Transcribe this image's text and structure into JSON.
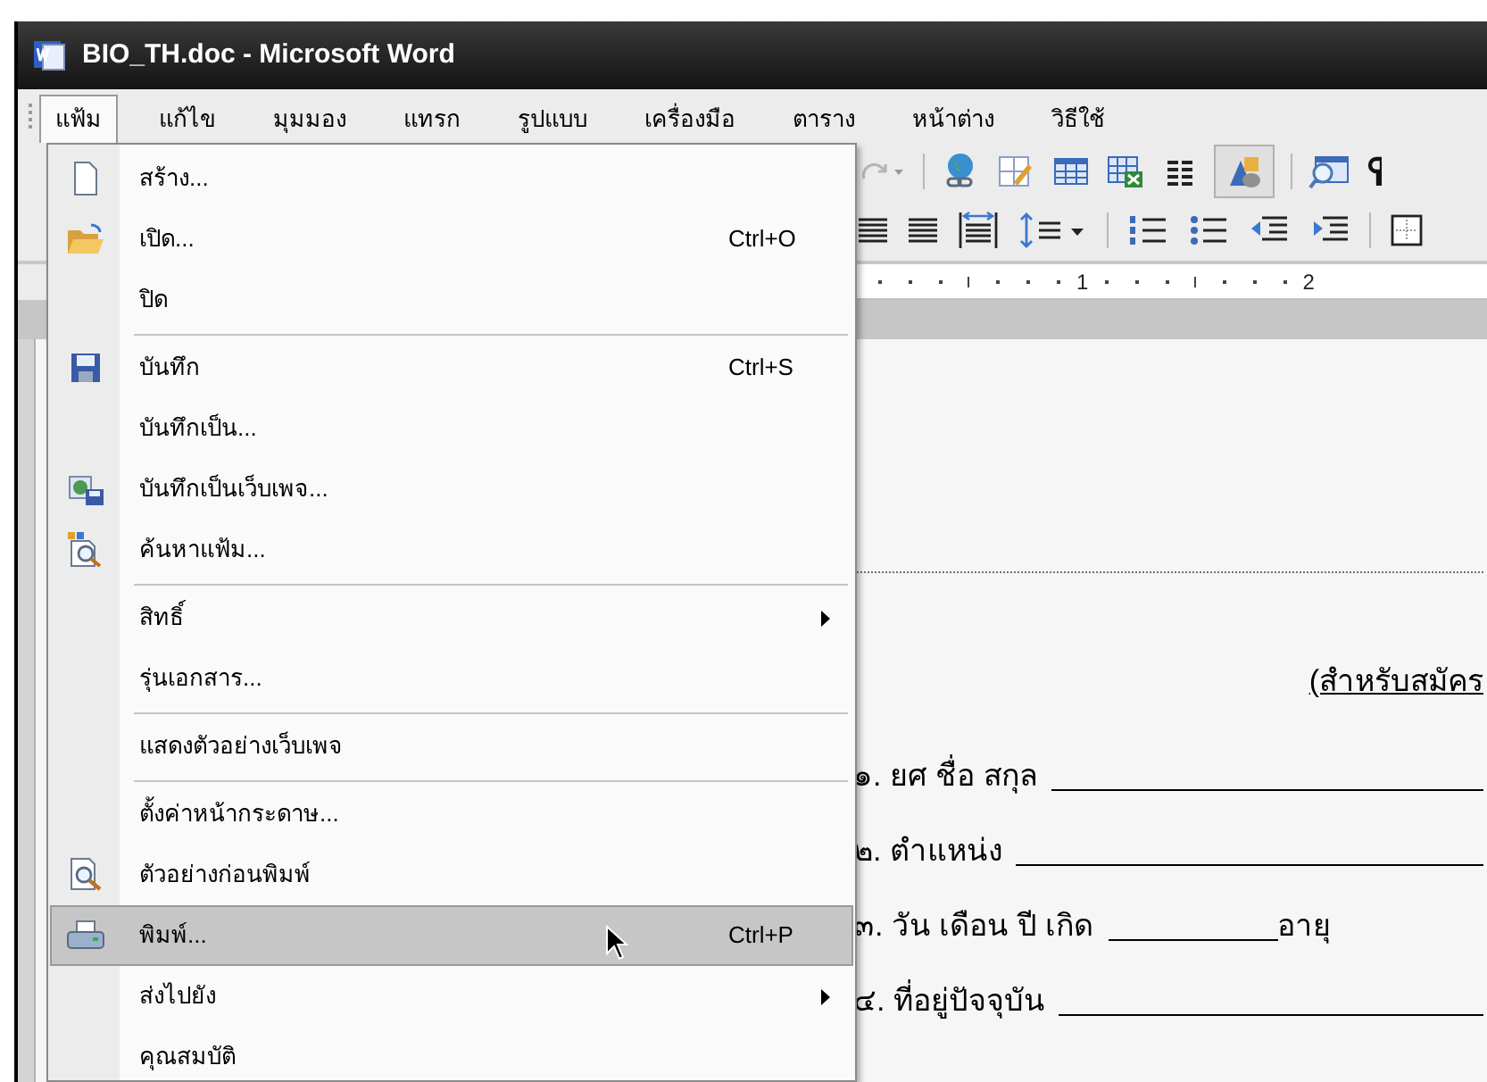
{
  "window": {
    "title": "BIO_TH.doc - Microsoft Word"
  },
  "menu_bar": [
    {
      "label": "แฟ้ม",
      "selected": true
    },
    {
      "label": "แก้ไข",
      "selected": false
    },
    {
      "label": "มุมมอง",
      "selected": false
    },
    {
      "label": "แทรก",
      "selected": false
    },
    {
      "label": "รูปแบบ",
      "selected": false
    },
    {
      "label": "เครื่องมือ",
      "selected": false
    },
    {
      "label": "ตาราง",
      "selected": false
    },
    {
      "label": "หน้าต่าง",
      "selected": false
    },
    {
      "label": "วิธีใช้",
      "selected": false
    }
  ],
  "file_menu": [
    {
      "kind": "item",
      "label": "สร้าง...",
      "selected": false,
      "submenu": false
    },
    {
      "kind": "item",
      "label": "เปิด...",
      "shortcut": "Ctrl+O",
      "selected": false,
      "submenu": false
    },
    {
      "kind": "item",
      "label": "ปิด",
      "selected": false,
      "submenu": false
    },
    {
      "kind": "separator"
    },
    {
      "kind": "item",
      "label": "บันทึก",
      "shortcut": "Ctrl+S",
      "selected": false,
      "submenu": false
    },
    {
      "kind": "item",
      "label": "บันทึกเป็น...",
      "selected": false,
      "submenu": false
    },
    {
      "kind": "item",
      "label": "บันทึกเป็นเว็บเพจ...",
      "selected": false,
      "submenu": false
    },
    {
      "kind": "item",
      "label": "ค้นหาแฟ้ม...",
      "selected": false,
      "submenu": false
    },
    {
      "kind": "separator"
    },
    {
      "kind": "item",
      "label": "สิทธิ์",
      "selected": false,
      "submenu": true
    },
    {
      "kind": "item",
      "label": "รุ่นเอกสาร...",
      "selected": false,
      "submenu": false
    },
    {
      "kind": "separator"
    },
    {
      "kind": "item",
      "label": "แสดงตัวอย่างเว็บเพจ",
      "selected": false,
      "submenu": false
    },
    {
      "kind": "separator"
    },
    {
      "kind": "item",
      "label": "ตั้งค่าหน้ากระดาษ...",
      "selected": false,
      "submenu": false
    },
    {
      "kind": "item",
      "label": "ตัวอย่างก่อนพิมพ์",
      "selected": false,
      "submenu": false
    },
    {
      "kind": "item",
      "label": "พิมพ์...",
      "shortcut": "Ctrl+P",
      "selected": true,
      "submenu": false
    },
    {
      "kind": "item",
      "label": "ส่งไปยัง",
      "selected": false,
      "submenu": true
    },
    {
      "kind": "item",
      "label": "คุณสมบัติ",
      "selected": false,
      "submenu": false
    }
  ],
  "ruler": {
    "marks": [
      "1",
      "2"
    ]
  },
  "document": {
    "heading": "(สำหรับสมัคร",
    "lines": [
      {
        "label": "๑. ยศ ชื่อ สกุล"
      },
      {
        "label": "๒. ตำแหน่ง"
      },
      {
        "label": "๓. วัน เดือน ปี เกิด",
        "after": "อายุ"
      },
      {
        "label": "๔. ที่อยู่ปัจจุบัน"
      }
    ]
  }
}
